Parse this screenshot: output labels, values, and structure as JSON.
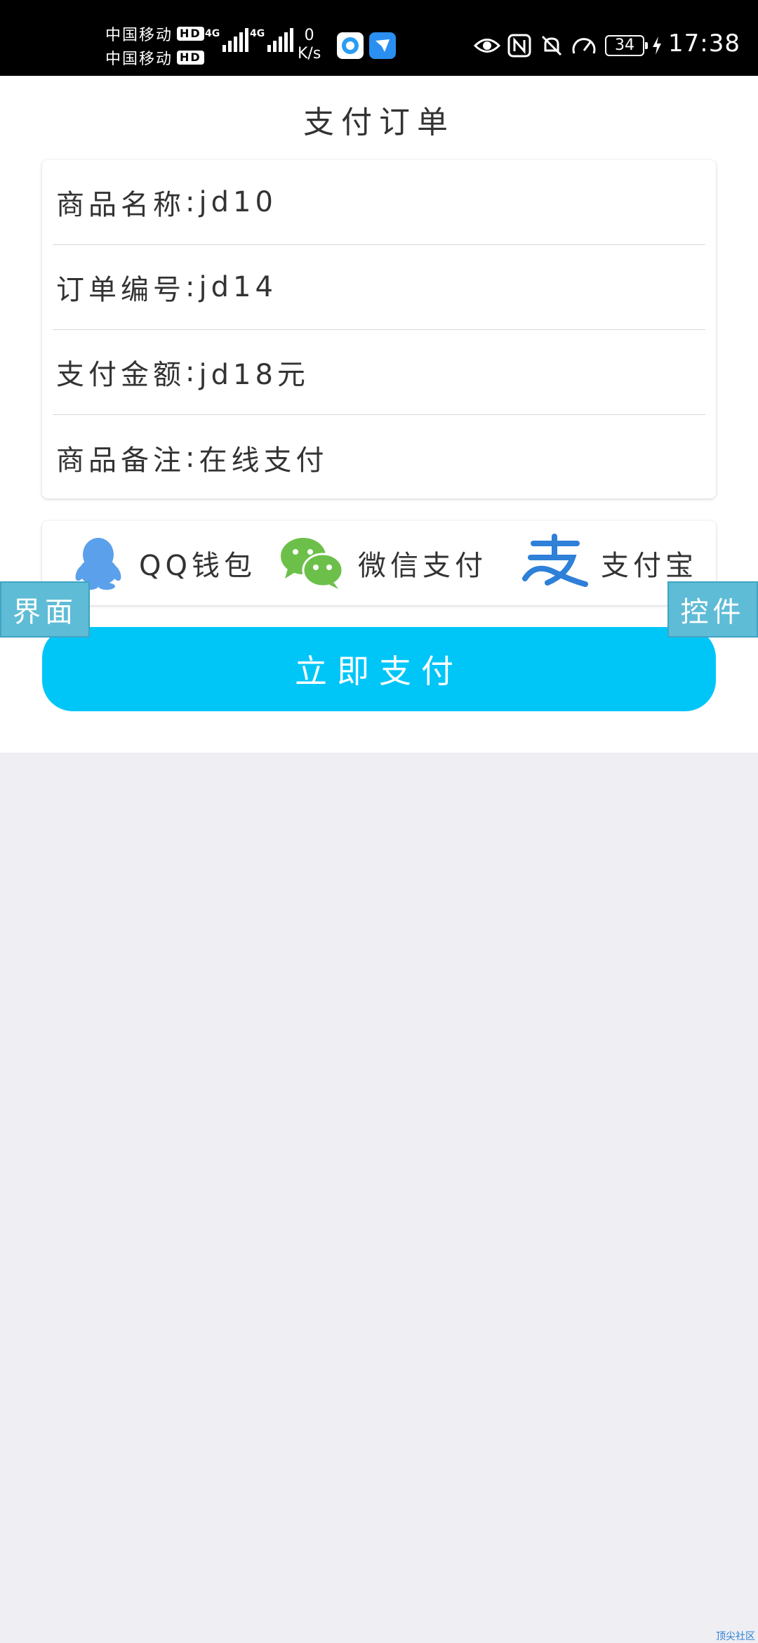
{
  "status_bar": {
    "carrier_1": "中国移动",
    "carrier_2": "中国移动",
    "hd_badge": "HD",
    "network_gen": "4G",
    "net_speed_value": "0",
    "net_speed_unit": "K/s",
    "battery_level": "34",
    "time": "17:38",
    "icons": [
      "eye-icon",
      "nfc-icon",
      "mute-icon",
      "speed-icon",
      "battery-icon",
      "charging-icon"
    ]
  },
  "page": {
    "title": "支付订单"
  },
  "order": {
    "rows": [
      {
        "label": "商品名称",
        "sep": ":",
        "value": "jd10"
      },
      {
        "label": "订单编号",
        "sep": ":",
        "value": "jd14"
      },
      {
        "label": "支付金额",
        "sep": ":",
        "value": "jd18元"
      },
      {
        "label": "商品备注",
        "sep": ":",
        "value": "在线支付"
      }
    ]
  },
  "payment_methods": [
    {
      "label": "QQ钱包",
      "icon": "qq-penguin-icon",
      "color": "#5aa0ea"
    },
    {
      "label": "微信支付",
      "icon": "wechat-icon",
      "color": "#6cc04a"
    },
    {
      "label": "支付宝",
      "icon": "alipay-icon",
      "color": "#2e80d8"
    }
  ],
  "pay_button": {
    "label": "立即支付",
    "color": "#00c6f8"
  },
  "floating_tabs": {
    "left": "界面",
    "right": "控件",
    "color": "#5fbcd6"
  },
  "watermark": "顶尖社区"
}
